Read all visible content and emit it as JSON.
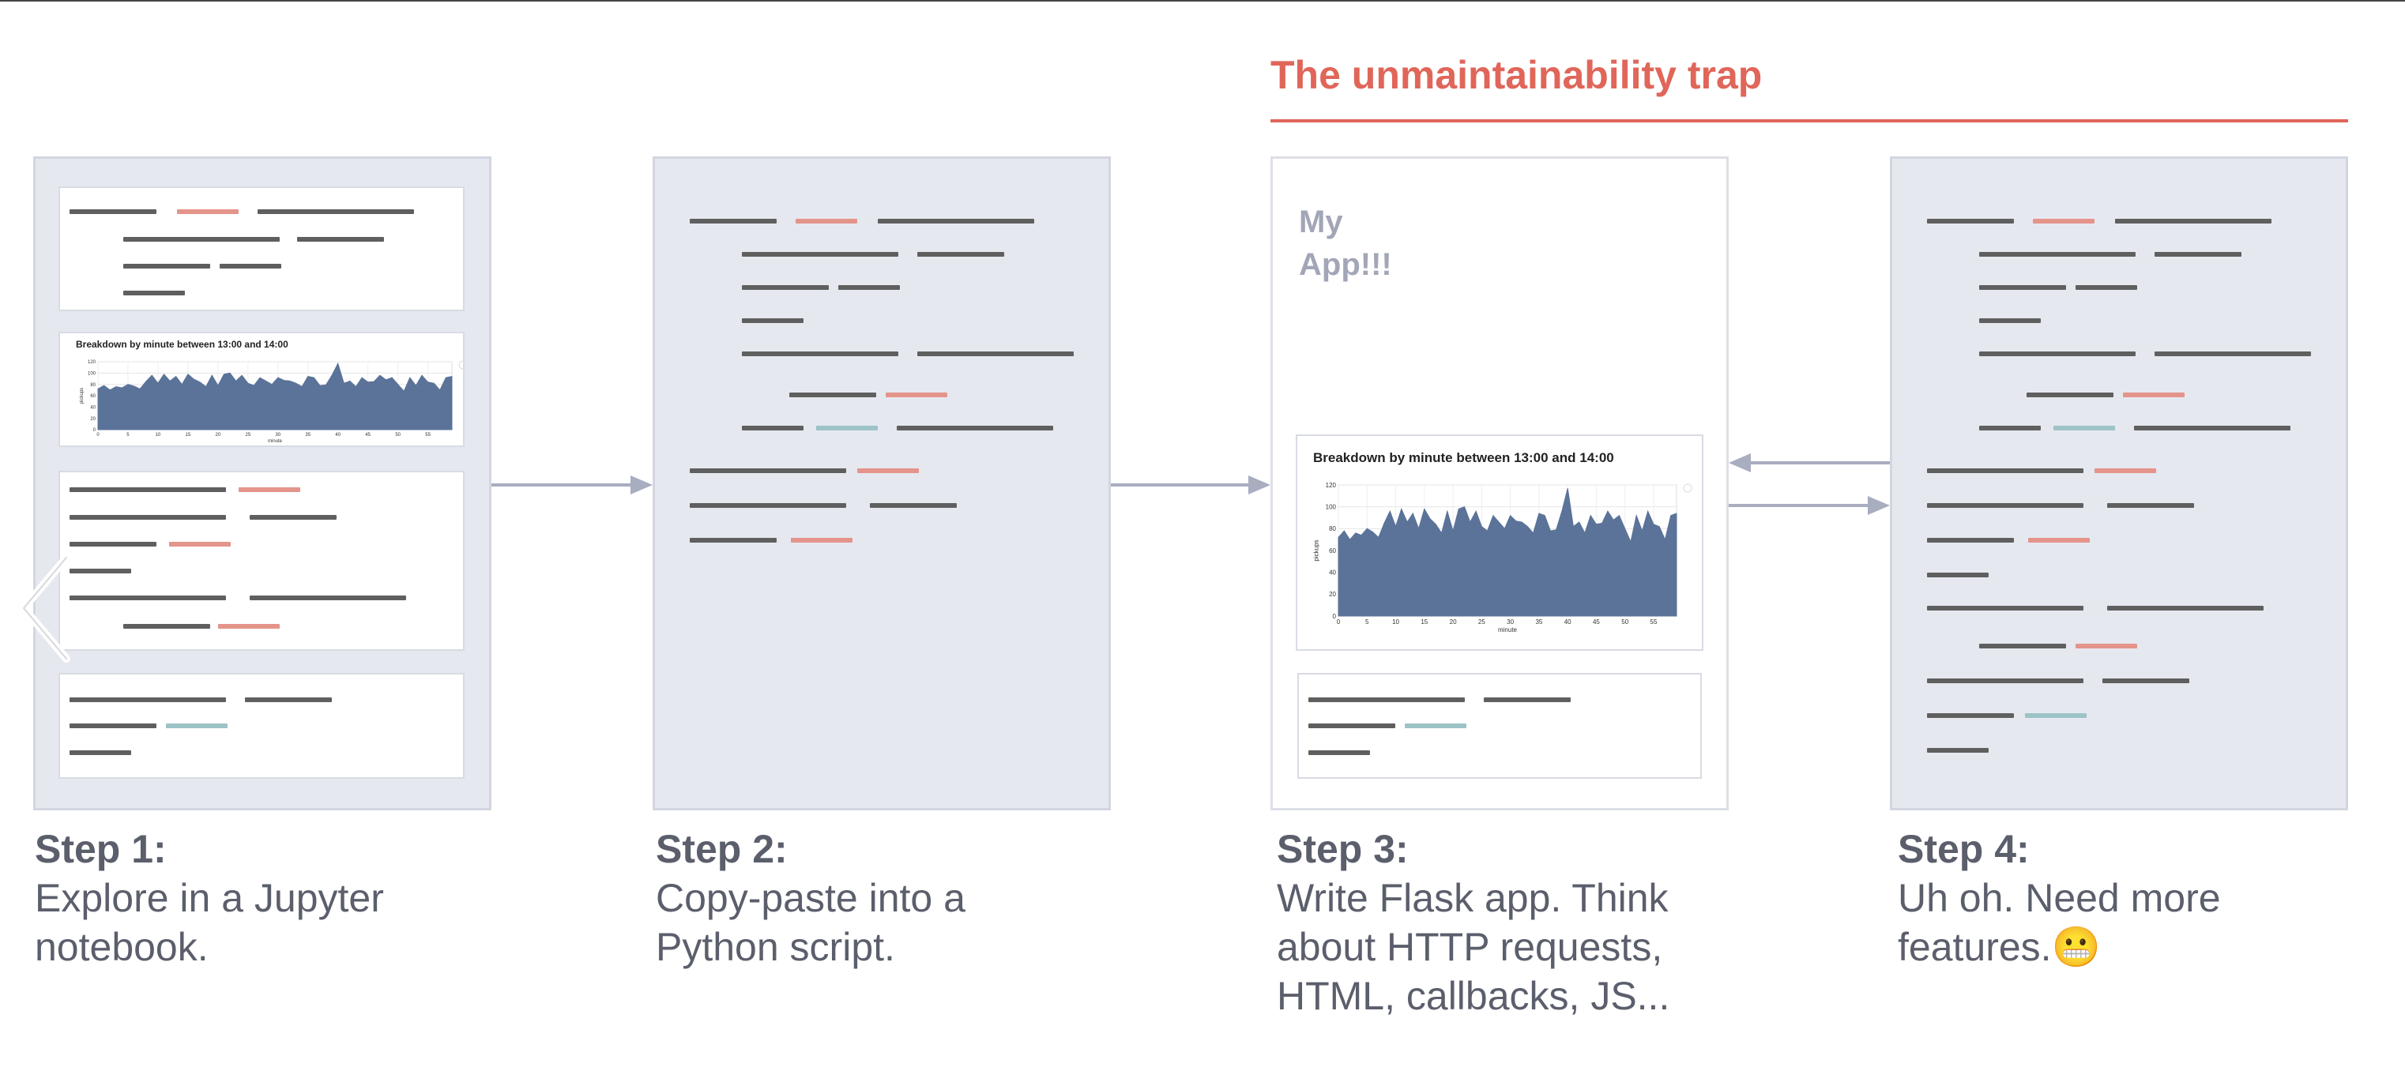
{
  "trap": {
    "title": "The unmaintainability trap",
    "color": "#e0665a"
  },
  "steps": [
    {
      "title": "Step 1:",
      "description": "Explore in a Jupyter\nnotebook."
    },
    {
      "title": "Step 2:",
      "description": "Copy-paste into a\nPython script."
    },
    {
      "title": "Step 3:",
      "description": "Write Flask app. Think\nabout HTTP requests,\nHTML, callbacks, JS..."
    },
    {
      "title": "Step 4:",
      "description": "Uh oh. Need more\nfeatures.",
      "emoji": "😬"
    }
  ],
  "app_mock": {
    "title": "My\nApp!!!"
  },
  "chart_data": [
    {
      "type": "area",
      "title": "Breakdown by minute between 13:00 and 14:00",
      "xlabel": "minute",
      "ylabel": "pickups",
      "xlim": [
        0,
        59
      ],
      "ylim": [
        0,
        120
      ],
      "xticks": [
        0,
        5,
        10,
        15,
        20,
        25,
        30,
        35,
        40,
        45,
        50,
        55
      ],
      "yticks": [
        0,
        20,
        40,
        60,
        80,
        100,
        120
      ],
      "series": [
        {
          "values": [
            72,
            78,
            70,
            76,
            74,
            80,
            77,
            72,
            85,
            96,
            82,
            98,
            86,
            94,
            80,
            98,
            89,
            84,
            76,
            96,
            78,
            98,
            100,
            86,
            96,
            82,
            78,
            92,
            86,
            80,
            92,
            87,
            86,
            82,
            76,
            94,
            92,
            78,
            79,
            96,
            117,
            82,
            86,
            76,
            92,
            84,
            85,
            96,
            88,
            92,
            80,
            68,
            92,
            78,
            96,
            84,
            82,
            70,
            92,
            94
          ]
        }
      ],
      "color": "#5b7399"
    },
    {
      "type": "area",
      "title": "Breakdown by minute between 13:00 and 14:00",
      "xlabel": "minute",
      "ylabel": "pickups",
      "xlim": [
        0,
        59
      ],
      "ylim": [
        0,
        120
      ],
      "xticks": [
        0,
        5,
        10,
        15,
        20,
        25,
        30,
        35,
        40,
        45,
        50,
        55
      ],
      "yticks": [
        0,
        20,
        40,
        60,
        80,
        100,
        120
      ],
      "series": [
        {
          "values": [
            72,
            78,
            70,
            76,
            74,
            80,
            77,
            72,
            85,
            96,
            82,
            98,
            86,
            94,
            80,
            98,
            89,
            84,
            76,
            96,
            78,
            98,
            100,
            86,
            96,
            82,
            78,
            92,
            86,
            80,
            92,
            87,
            86,
            82,
            76,
            94,
            92,
            78,
            79,
            96,
            117,
            82,
            86,
            76,
            92,
            84,
            85,
            96,
            88,
            92,
            80,
            68,
            92,
            78,
            96,
            84,
            82,
            70,
            92,
            94
          ]
        }
      ],
      "color": "#5b7399"
    }
  ]
}
